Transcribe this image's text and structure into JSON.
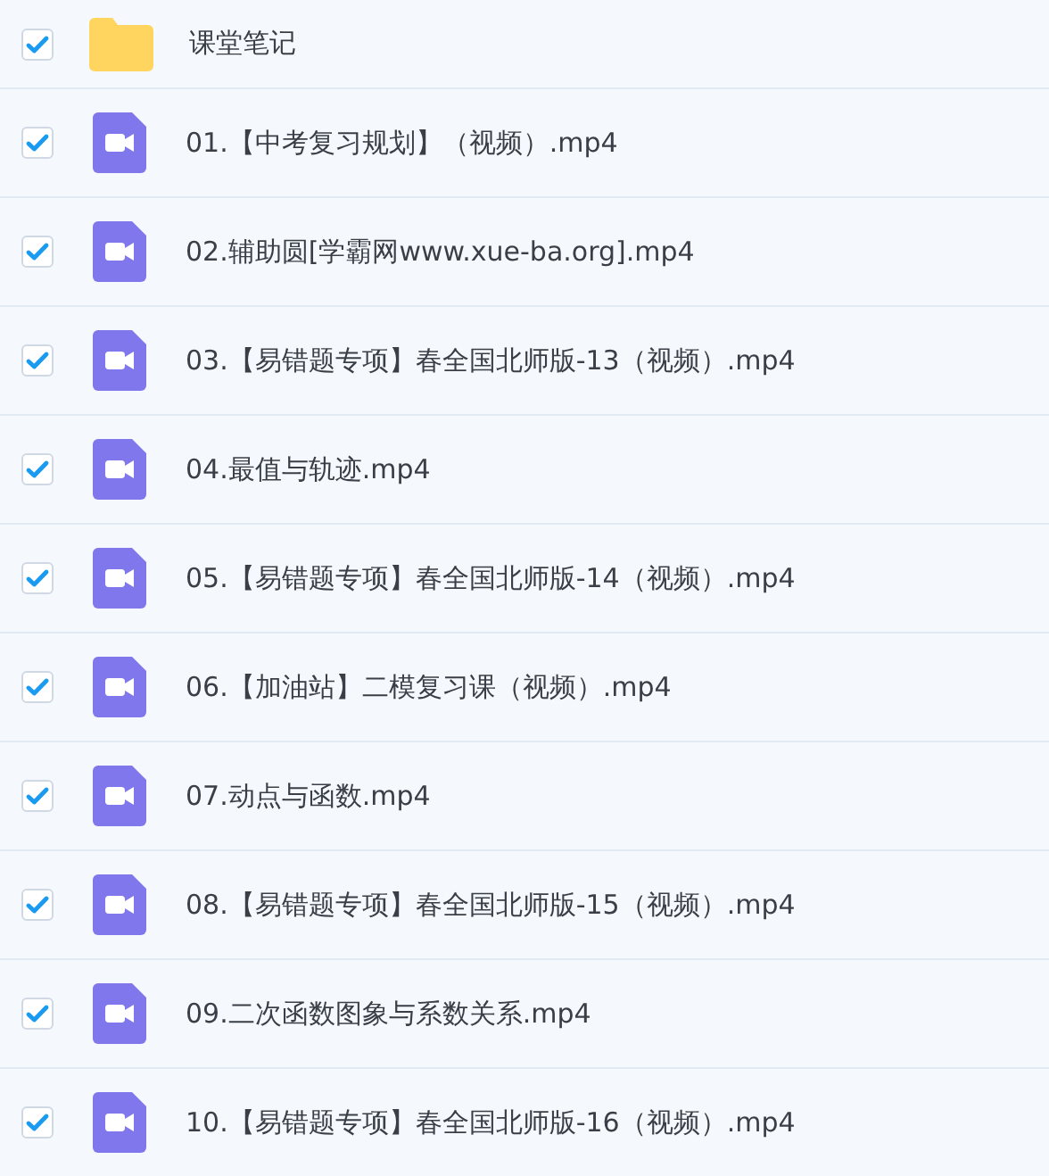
{
  "files": [
    {
      "kind": "folder",
      "name": "课堂笔记",
      "checked": true
    },
    {
      "kind": "video",
      "name": "01.【中考复习规划】（视频）.mp4",
      "checked": true
    },
    {
      "kind": "video",
      "name": "02.辅助圆[学霸网www.xue-ba.org].mp4",
      "checked": true
    },
    {
      "kind": "video",
      "name": "03.【易错题专项】春全国北师版-13（视频）.mp4",
      "checked": true
    },
    {
      "kind": "video",
      "name": "04.最值与轨迹.mp4",
      "checked": true
    },
    {
      "kind": "video",
      "name": "05.【易错题专项】春全国北师版-14（视频）.mp4",
      "checked": true
    },
    {
      "kind": "video",
      "name": "06.【加油站】二模复习课（视频）.mp4",
      "checked": true
    },
    {
      "kind": "video",
      "name": "07.动点与函数.mp4",
      "checked": true
    },
    {
      "kind": "video",
      "name": "08.【易错题专项】春全国北师版-15（视频）.mp4",
      "checked": true
    },
    {
      "kind": "video",
      "name": "09.二次函数图象与系数关系.mp4",
      "checked": true
    },
    {
      "kind": "video",
      "name": "10.【易错题专项】春全国北师版-16（视频）.mp4",
      "checked": true
    }
  ]
}
